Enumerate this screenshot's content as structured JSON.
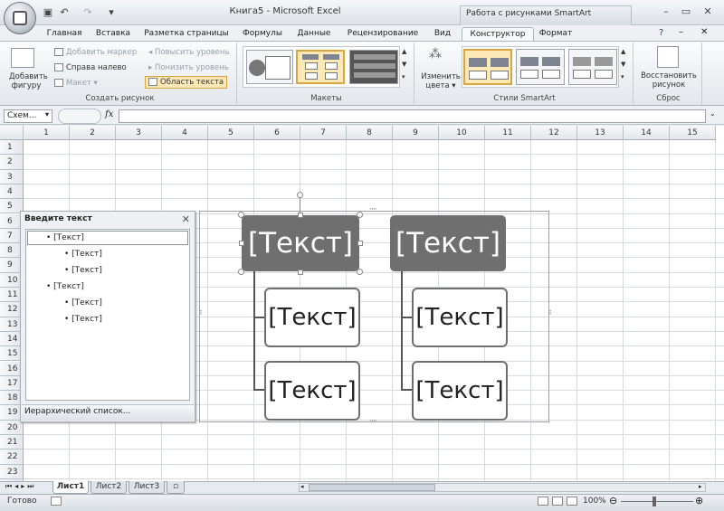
{
  "window": {
    "title": "Книга5 - Microsoft Excel",
    "context_header": "Работа с рисунками SmartArt"
  },
  "tabs": [
    "Главная",
    "Вставка",
    "Разметка страницы",
    "Формулы",
    "Данные",
    "Рецензирование",
    "Вид",
    "Конструктор",
    "Формат"
  ],
  "ribbon": {
    "create_group": {
      "add_shape": "Добавить фигуру",
      "add_bullet": "Добавить маркер",
      "right_to_left": "Справа налево",
      "layout": "Макет",
      "promote": "Повысить уровень",
      "demote": "Понизить уровень",
      "text_pane": "Область текста",
      "label": "Создать рисунок"
    },
    "layouts_label": "Макеты",
    "styles": {
      "change_colors": "Изменить цвета",
      "label": "Стили SmartArt"
    },
    "reset": {
      "restore": "Восстановить рисунок",
      "label": "Сброс"
    }
  },
  "formula_bar": {
    "name_box": "Схем...",
    "fx": "fx",
    "formula": ""
  },
  "columns": [
    "1",
    "2",
    "3",
    "4",
    "5",
    "6",
    "7",
    "8",
    "9",
    "10",
    "11",
    "12",
    "13",
    "14",
    "15"
  ],
  "rows": [
    "1",
    "2",
    "3",
    "4",
    "5",
    "6",
    "7",
    "8",
    "9",
    "10",
    "11",
    "12",
    "13",
    "14",
    "15",
    "16",
    "17",
    "18",
    "19",
    "20",
    "21",
    "22",
    "23",
    "24"
  ],
  "text_pane": {
    "title": "Введите текст",
    "items": [
      {
        "level": 1,
        "text": "[Текст]"
      },
      {
        "level": 2,
        "text": "[Текст]"
      },
      {
        "level": 2,
        "text": "[Текст]"
      },
      {
        "level": 1,
        "text": "[Текст]"
      },
      {
        "level": 2,
        "text": "[Текст]"
      },
      {
        "level": 2,
        "text": "[Текст]"
      }
    ],
    "footer": "Иерархический список..."
  },
  "smartart": {
    "parent1": "[Текст]",
    "parent2": "[Текст]",
    "child1a": "[Текст]",
    "child1b": "[Текст]",
    "child2a": "[Текст]",
    "child2b": "[Текст]",
    "fill_color": "#6f6f6f"
  },
  "sheets": [
    "Лист1",
    "Лист2",
    "Лист3"
  ],
  "status": {
    "ready": "Готово",
    "zoom": "100%"
  }
}
